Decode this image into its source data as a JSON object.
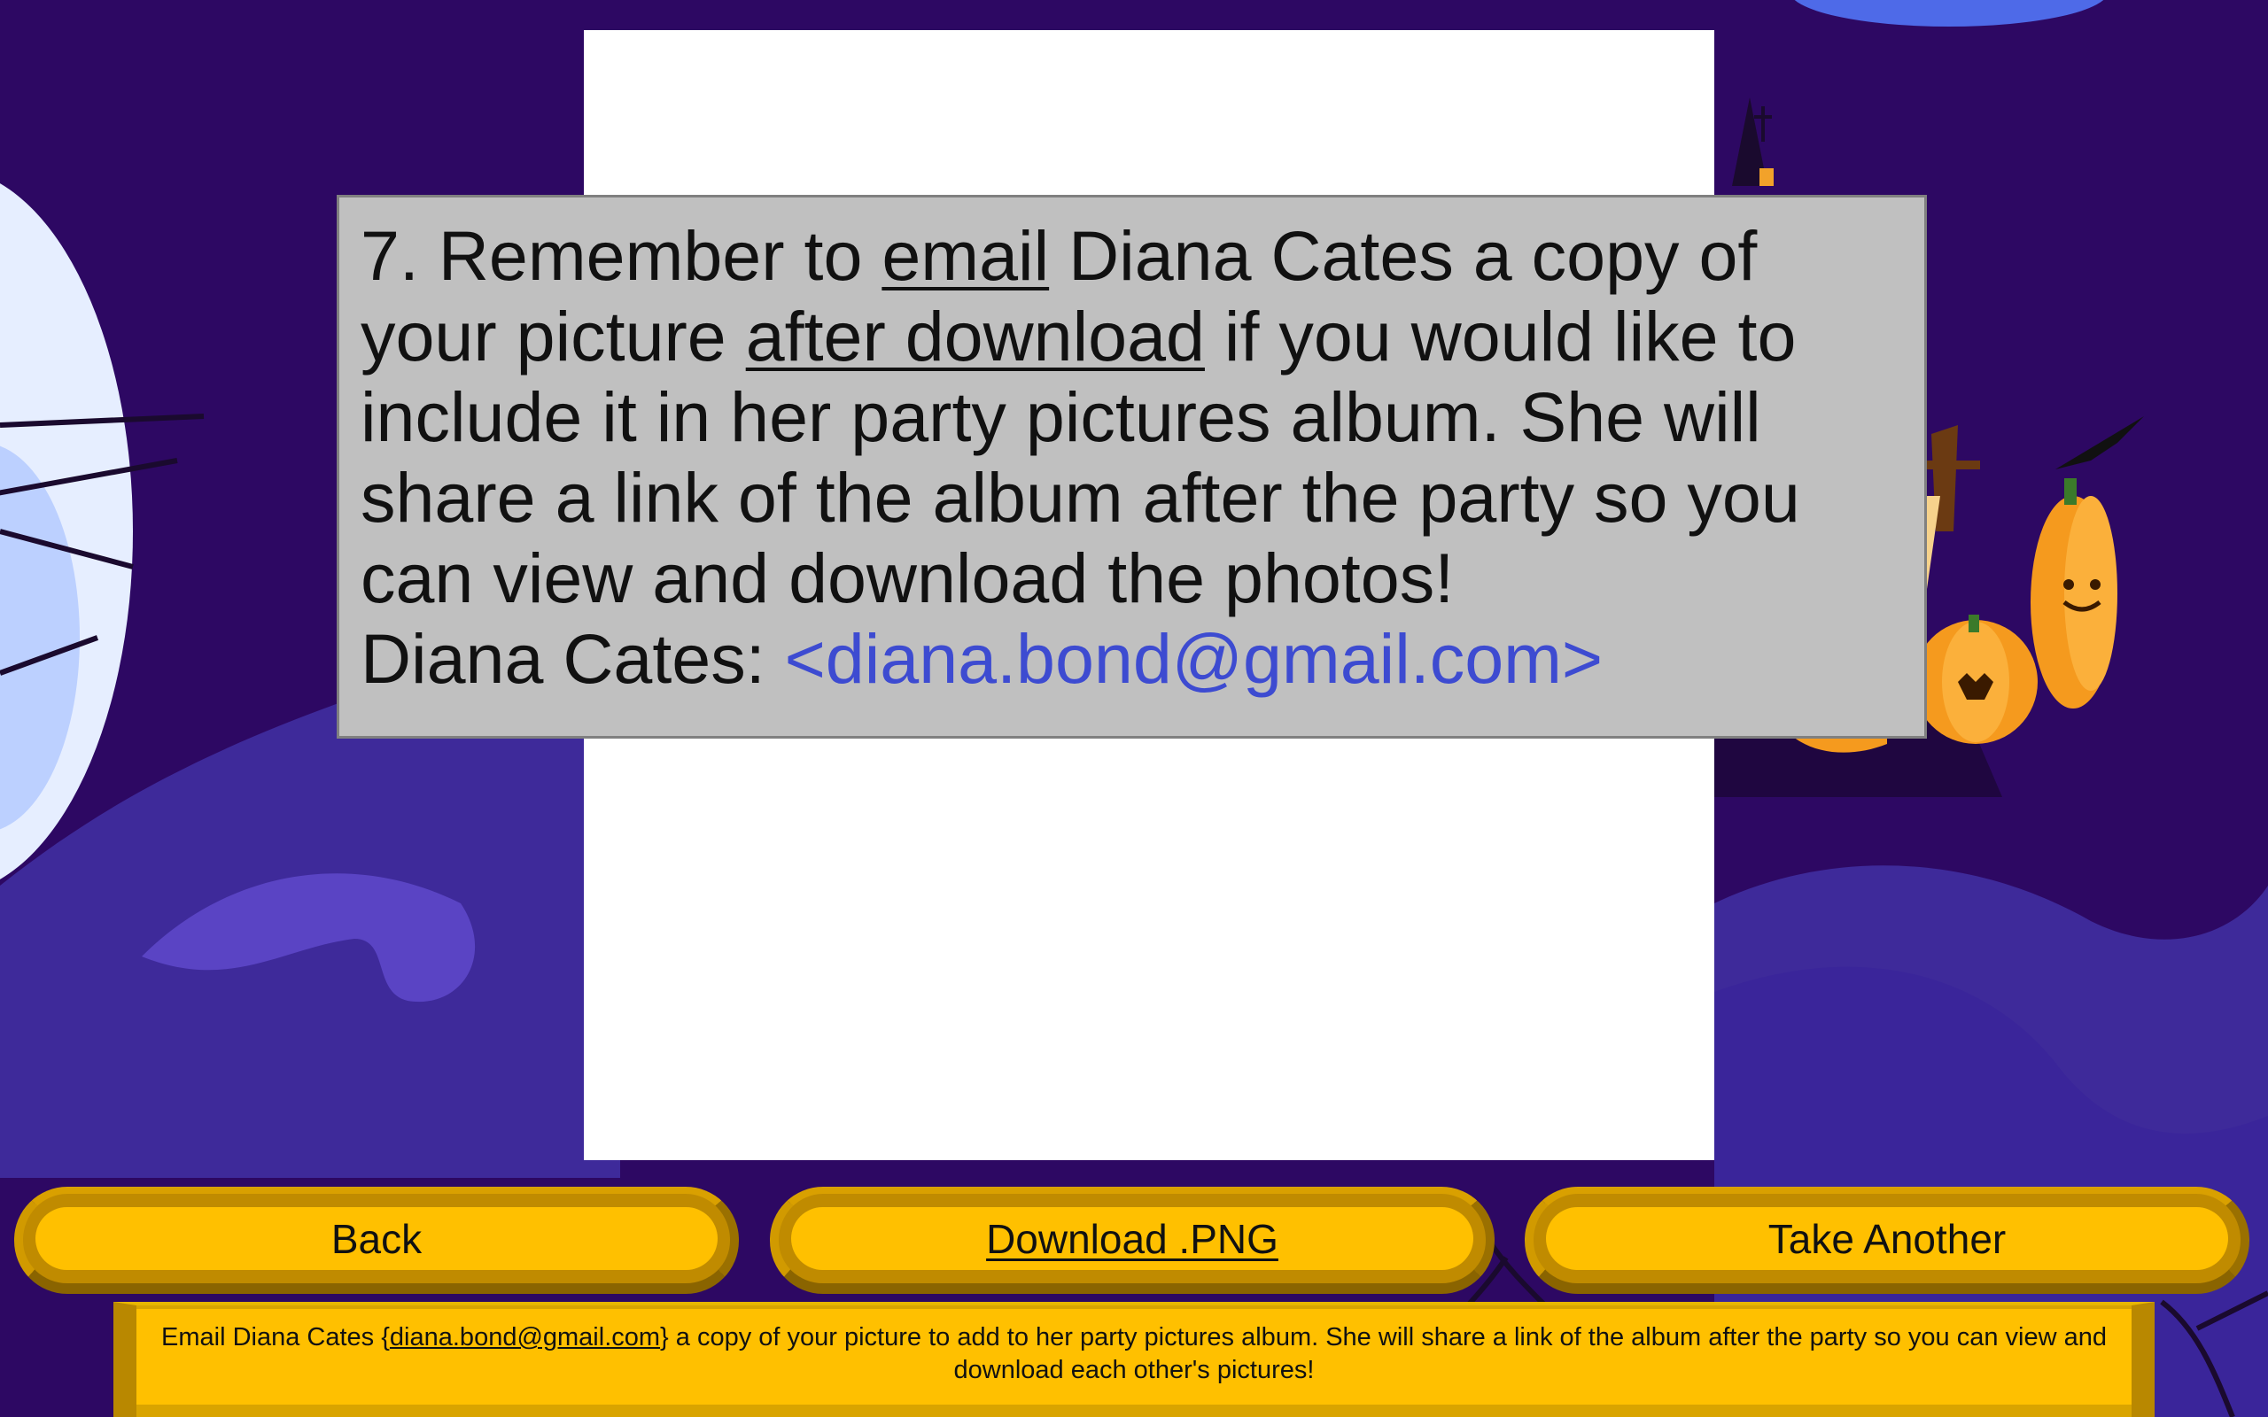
{
  "theme": {
    "background": "#2d0863",
    "accent": "#ffc000",
    "link_color": "#3d4bd1"
  },
  "instructions": {
    "step_prefix": "7. Remember to ",
    "email_word": "email",
    "mid1": " Diana Cates a copy of your picture ",
    "after_download": "after download",
    "rest": " if you would like to include it in her party pictures album. She will share a link of the album after the party so you can view and download the photos!",
    "contact_name": "Diana Cates: ",
    "contact_email": "<diana.bond@gmail.com>"
  },
  "buttons": {
    "back": "Back",
    "download": "Download .PNG",
    "take_another": "Take Another"
  },
  "footer": {
    "before": "Email Diana Cates {",
    "email_link": "diana.bond@gmail.com",
    "after": "} a copy of your picture to add to her party pictures album. She will share a link of the album after the party so you can view and download each other's pictures!"
  }
}
